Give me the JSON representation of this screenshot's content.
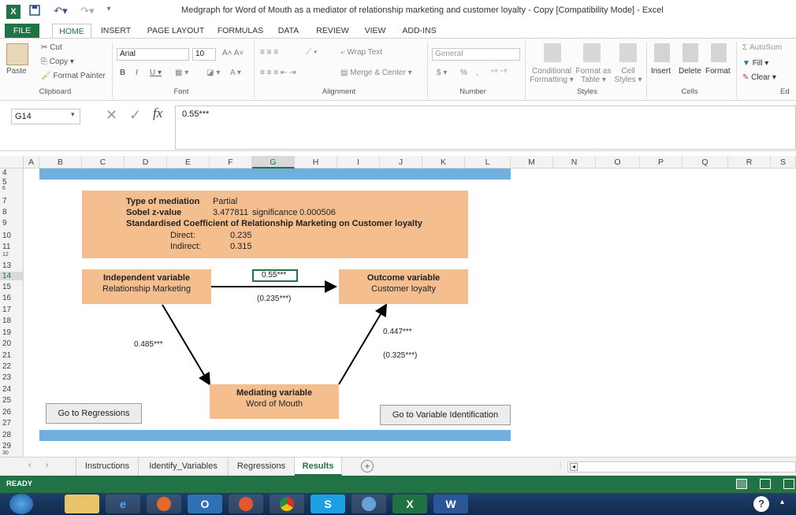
{
  "window": {
    "title": "Medgraph for Word of Mouth as a mediator of relationship marketing and customer loyalty - Copy  [Compatibility Mode] - Excel"
  },
  "tabs": [
    "FILE",
    "HOME",
    "INSERT",
    "PAGE LAYOUT",
    "FORMULAS",
    "DATA",
    "REVIEW",
    "VIEW",
    "ADD-INS"
  ],
  "ribbon": {
    "clipboard": {
      "paste": "Paste",
      "cut": "Cut",
      "copy": "Copy",
      "format_painter": "Format Painter",
      "group": "Clipboard"
    },
    "font": {
      "name": "Arial",
      "size": "10",
      "group": "Font"
    },
    "alignment": {
      "wrap": "Wrap Text",
      "merge": "Merge & Center",
      "group": "Alignment"
    },
    "number": {
      "format": "General",
      "currency": "$",
      "percent": "%",
      "comma": ",",
      "group": "Number"
    },
    "styles": {
      "conditional": "Conditional",
      "conditional2": "Formatting",
      "format_as": "Format as",
      "format_as2": "Table",
      "cell": "Cell",
      "cell2": "Styles",
      "group": "Styles"
    },
    "cells": {
      "insert": "Insert",
      "delete": "Delete",
      "format": "Format",
      "group": "Cells"
    },
    "editing": {
      "autosum": "AutoSum",
      "fill": "Fill",
      "clear": "Clear",
      "group": "Ed"
    }
  },
  "formula_bar": {
    "name_box": "G14",
    "fx": "fx",
    "value": "0.55***"
  },
  "columns": [
    "A",
    "B",
    "C",
    "D",
    "E",
    "F",
    "G",
    "H",
    "I",
    "J",
    "K",
    "L",
    "M",
    "N",
    "O",
    "P",
    "Q",
    "R",
    "S"
  ],
  "rows": [
    "4",
    "5",
    "6",
    "7",
    "8",
    "9",
    "10",
    "11",
    "12",
    "13",
    "14",
    "15",
    "16",
    "17",
    "18",
    "19",
    "20",
    "21",
    "22",
    "23",
    "24",
    "25",
    "26",
    "27",
    "28",
    "29",
    "30"
  ],
  "model": {
    "type_label": "Type of mediation",
    "type_value": "Partial",
    "sobel_label": "Sobel z-value",
    "sobel_value": "3.477811",
    "sig_label": "significance",
    "sig_value": "0.000506",
    "coef_title": "Standardised Coefficient of Relationship Marketing on Customer loyalty",
    "direct_label": "Direct:",
    "direct_value": "0.235",
    "indirect_label": "Indirect:",
    "indirect_value": "0.315",
    "iv_title": "Independent variable",
    "iv_name": "Relationship Marketing",
    "ov_title": "Outcome variable",
    "ov_name": "Customer loyalty",
    "mv_title": "Mediating variable",
    "mv_name": "Word of Mouth",
    "path_c": "0.55***",
    "path_c_prime": "(0.235***)",
    "path_a": "0.485***",
    "path_b": "0.447***",
    "path_b_prime": "(0.325***)"
  },
  "buttons": {
    "regressions": "Go to Regressions",
    "variables": "Go to Variable Identification"
  },
  "sheets": [
    "Instructions",
    "Identify_Variables",
    "Regressions",
    "Results"
  ],
  "status": {
    "ready": "READY"
  },
  "taskbar": [
    "O",
    "S",
    "X",
    "W"
  ]
}
